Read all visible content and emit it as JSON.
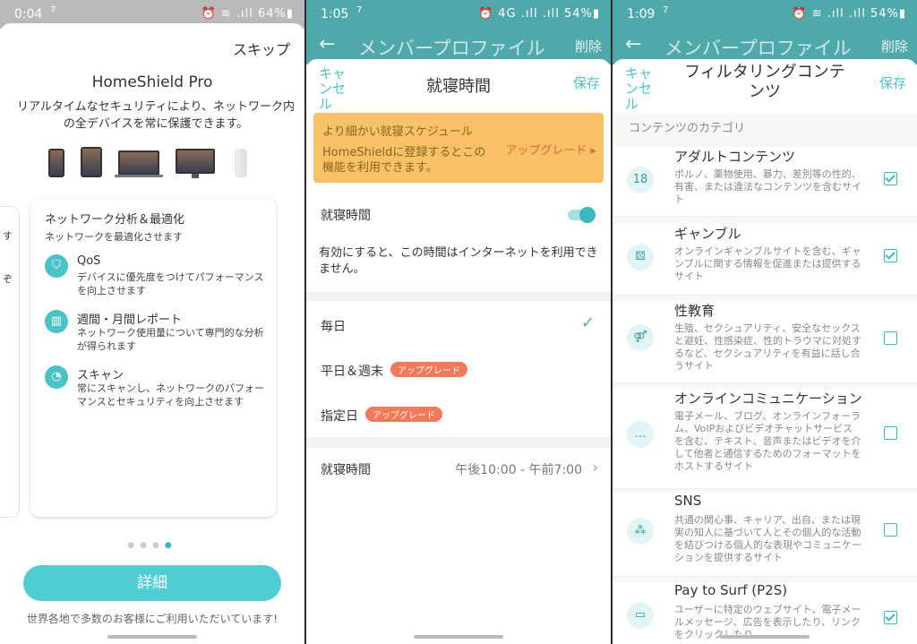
{
  "panel1": {
    "status": {
      "time": "0:04",
      "indicator": "7",
      "icons": "⏰ ≋ .ıll 64%▮"
    },
    "skip": "スキップ",
    "title": "HomeShield Pro",
    "desc": "リアルタイムなセキュリティにより、ネットワーク内の全デバイスを常に保護できます。",
    "card": {
      "title": "ネットワーク分析＆最適化",
      "subtitle": "ネットワークを最適化させます",
      "features": [
        {
          "icon": "shield-icon",
          "glyph": "⛉",
          "title": "QoS",
          "desc": "デバイスに優先度をつけてパフォーマンスを向上させます"
        },
        {
          "icon": "report-icon",
          "glyph": "▥",
          "title": "週間・月間レポート",
          "desc": "ネットワーク使用量について専門的な分析が得られます"
        },
        {
          "icon": "scan-icon",
          "glyph": "◔",
          "title": "スキャン",
          "desc": "常にスキャンし、ネットワークのパフォーマンスとセキュリティを向上させます"
        }
      ]
    },
    "left_card_text": [
      "す",
      "ぞ"
    ],
    "detail_button": "詳細",
    "footer": "世界各地で多数のお客様にご利用いただいています!"
  },
  "panel2": {
    "status": {
      "time": "1:05",
      "indicator": "7",
      "icons": "⏰ 4G .ıll .ıll 54%▮"
    },
    "nav": {
      "back": "←",
      "title": "メンバープロファイル",
      "delete": "削除"
    },
    "sheet": {
      "cancel": "キャンセル",
      "title": "就寝時間",
      "save": "保存"
    },
    "banner": {
      "title": "より細かい就寝スケジュール",
      "body": "HomeShieldに登録するとこの機能を利用できます。",
      "upgrade": "アップグレード ▸"
    },
    "bedtime_label": "就寝時間",
    "bedtime_enabled": true,
    "note": "有効にすると、この時間はインターネットを利用できません。",
    "options": [
      {
        "label": "毎日",
        "selected": true,
        "badge": ""
      },
      {
        "label": "平日＆週末",
        "selected": false,
        "badge": "アップグレード"
      },
      {
        "label": "指定日",
        "selected": false,
        "badge": "アップグレード"
      }
    ],
    "time_row": {
      "label": "就寝時間",
      "value": "午後10:00 - 午前7:00"
    }
  },
  "panel3": {
    "status": {
      "time": "1:09",
      "indicator": "7",
      "icons": "⏰ ≋ .ıll .ıll 54%▮"
    },
    "nav": {
      "back": "←",
      "title": "メンバープロファイル",
      "delete": "削除"
    },
    "sheet": {
      "cancel": "キャンセル",
      "title": "フィルタリングコンテンツ",
      "save": "保存"
    },
    "category_label": "コンテンツのカテゴリ",
    "categories": [
      {
        "icon": "adult-icon",
        "glyph": "18",
        "name": "アダルトコンテンツ",
        "desc": "ポルノ、薬物使用、暴力、差別等の性的、有害、または違法なコンテンツを含むサイト",
        "checked": true
      },
      {
        "icon": "dice-icon",
        "glyph": "⚄",
        "name": "ギャンブル",
        "desc": "オンラインギャンブルサイトを含む、ギャンブルに関する情報を促進または提供するサイト",
        "checked": true
      },
      {
        "icon": "sex-education-icon",
        "glyph": "⚤",
        "name": "性教育",
        "desc": "生殖、セクシュアリティ、安全なセックスと避妊、性感染症、性的トラウマに対処するなど、セクシュアリティを有益に話し合うサイト",
        "checked": false
      },
      {
        "icon": "chat-icon",
        "glyph": "…",
        "name": "オンラインコミュニケーション",
        "desc": "電子メール、ブログ、オンラインフォーラム、VoIPおよびビデオチャットサービスを含む、テキスト、音声またはビデオを介して他者と通信するためのフォーマットをホストするサイト",
        "checked": false
      },
      {
        "icon": "network-icon",
        "glyph": "⁂",
        "name": "SNS",
        "desc": "共通の関心事、キャリア、出自、または現実の知人に基づいて人とその個人的な活動を結びつける個人的な表現やコミュニケーションを提供するサイト",
        "checked": false
      },
      {
        "icon": "pay-icon",
        "glyph": "▭",
        "name": "Pay to Surf (P2S)",
        "desc": "ユーザーに特定のウェブサイト、電子メールメッセージ、広告を表示したり、リンクをクリックしたり、",
        "checked": true
      }
    ]
  }
}
